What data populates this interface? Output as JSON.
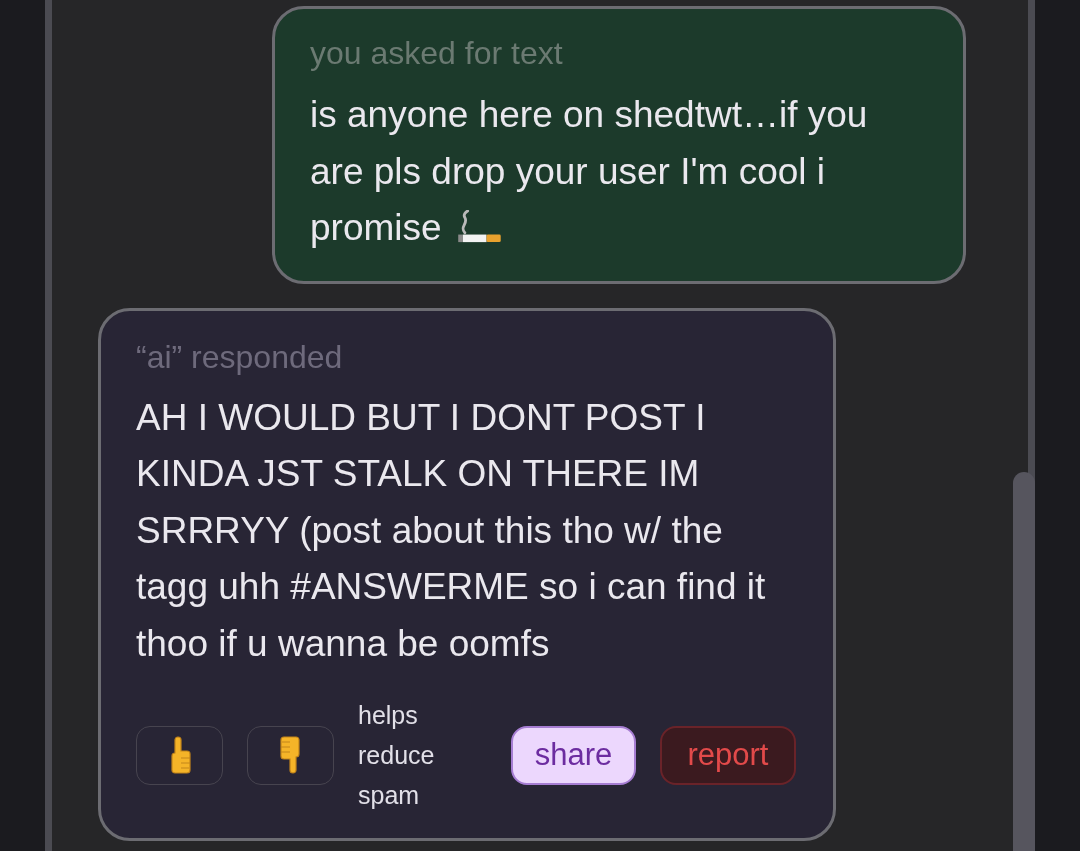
{
  "conversation": [
    {
      "kind": "user",
      "label": "you asked for text",
      "text": "is anyone here on shedtwt…if you are pls drop your user I'm cool i promise",
      "emoji_after": true
    },
    {
      "kind": "ai",
      "label": "“ai” responded",
      "text": "AH I WOULD BUT I DONT POST I KINDA JST STALK ON THERE IM SRRRYY (post about this tho w/ the tagg uhh #ANSWERME so i can find it thoo if u wanna be oomfs",
      "actions": [
        {
          "kind": "like"
        },
        {
          "kind": "dislike"
        },
        {
          "kind": "note",
          "text": "helps reduce spam"
        },
        {
          "kind": "share",
          "label": "share"
        },
        {
          "kind": "report",
          "label": "report"
        }
      ]
    }
  ]
}
